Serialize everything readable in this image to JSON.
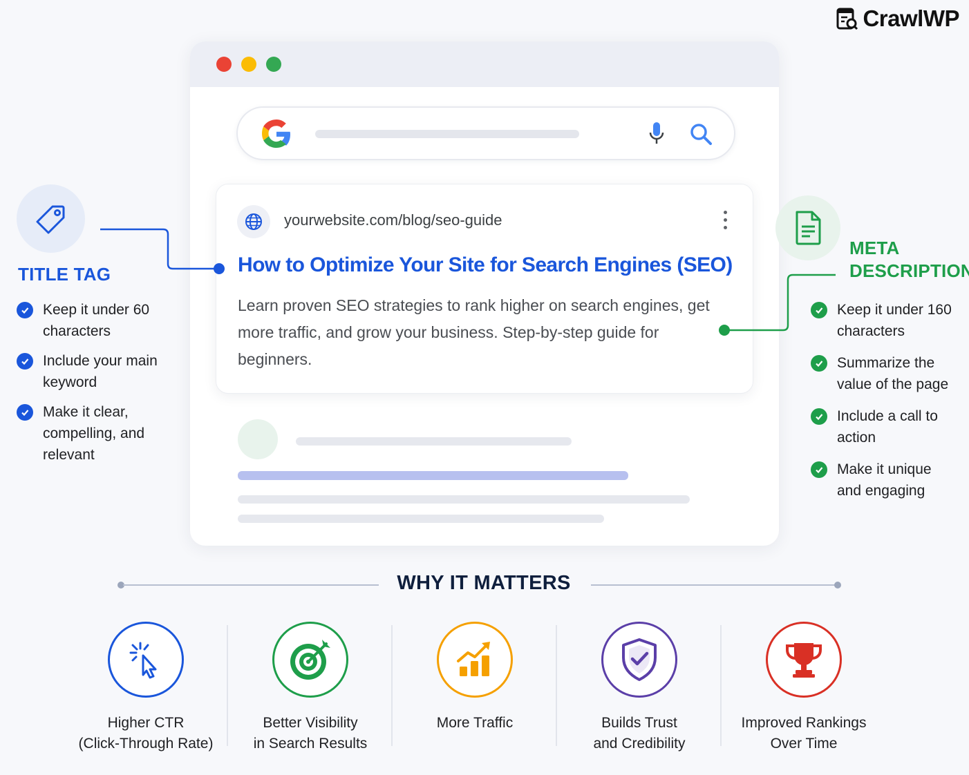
{
  "brand": {
    "name": "CrawlWP",
    "icon": "document-search-icon"
  },
  "browser": {
    "window_dots": [
      "#ea4335",
      "#fbbc05",
      "#34a853"
    ],
    "search": {
      "logo": "google-g-icon",
      "mic_icon": "microphone-icon",
      "search_icon": "search-icon"
    },
    "result": {
      "url": "yourwebsite.com/blog/seo-guide",
      "title": "How to Optimize Your Site for Search Engines (SEO)",
      "description": "Learn proven SEO strategies to rank higher on search engines, get more traffic, and grow your business. Step-by-step guide for beginners."
    }
  },
  "title_tag": {
    "heading": "TITLE TAG",
    "color": "#1a56db",
    "icon": "tag-icon",
    "items": [
      "Keep it under 60 characters",
      "Include your main keyword",
      "Make it clear, compelling, and relevant"
    ]
  },
  "meta_description": {
    "heading_line1": "META",
    "heading_line2": "DESCRIPTION",
    "color": "#1e9e4a",
    "icon": "document-icon",
    "items": [
      "Keep it under 160 characters",
      "Summarize the value of the page",
      "Include a call to action",
      "Make it unique and engaging"
    ]
  },
  "why": {
    "title": "WHY IT MATTERS",
    "benefits": [
      {
        "label": "Higher CTR\n(Click-Through Rate)",
        "icon": "click-cursor-icon",
        "color": "#1a56db"
      },
      {
        "label": "Better Visibility\nin Search Results",
        "icon": "target-icon",
        "color": "#1e9e4a"
      },
      {
        "label": "More Traffic",
        "icon": "growth-chart-icon",
        "color": "#f5a000"
      },
      {
        "label": "Builds Trust\nand Credibility",
        "icon": "shield-check-icon",
        "color": "#5b3fa8"
      },
      {
        "label": "Improved Rankings\nOver Time",
        "icon": "trophy-icon",
        "color": "#d93025"
      }
    ]
  }
}
